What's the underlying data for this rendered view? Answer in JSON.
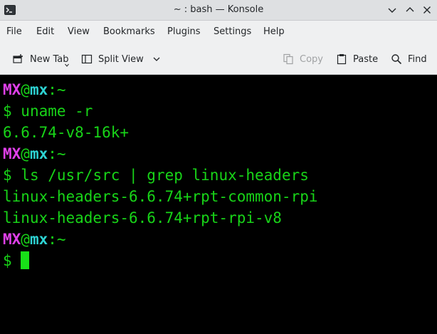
{
  "window": {
    "title": "~ : bash — Konsole"
  },
  "menubar": {
    "items": [
      "File",
      "Edit",
      "View",
      "Bookmarks",
      "Plugins",
      "Settings",
      "Help"
    ]
  },
  "toolbar": {
    "new_tab": "New Tab",
    "split_view": "Split View",
    "copy": "Copy",
    "paste": "Paste",
    "find": "Find"
  },
  "terminal": {
    "user": "MX",
    "at": "@",
    "host": "mx",
    "path": ":~",
    "prompt": "$ ",
    "lines": [
      {
        "type": "prompt"
      },
      {
        "type": "cmd",
        "text": "uname -r"
      },
      {
        "type": "out",
        "text": "6.6.74-v8-16k+"
      },
      {
        "type": "prompt"
      },
      {
        "type": "cmd",
        "text": "ls /usr/src | grep linux-headers"
      },
      {
        "type": "out",
        "text": "linux-headers-6.6.74+rpt-common-rpi"
      },
      {
        "type": "out",
        "text": "linux-headers-6.6.74+rpt-rpi-v8"
      },
      {
        "type": "prompt"
      },
      {
        "type": "cursor"
      }
    ]
  },
  "colors": {
    "terminal_bg": "#000000",
    "terminal_fg": "#18d418",
    "user_color": "#e040ea",
    "host_color": "#2ed4d4",
    "chrome_bg": "#eff0f1"
  }
}
